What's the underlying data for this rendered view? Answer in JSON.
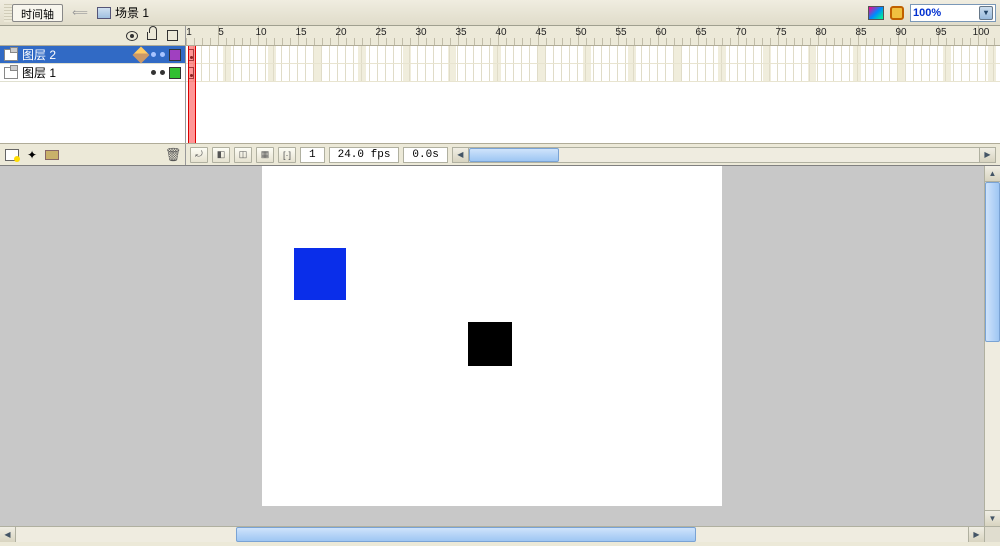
{
  "topbar": {
    "timeline_btn": "时间轴",
    "scene_label": "场景 1",
    "zoom_value": "100%"
  },
  "ruler": {
    "start": 1,
    "major_step": 5,
    "max": 105
  },
  "layers": [
    {
      "name": "图层 2",
      "selected": true,
      "color": "#a040c0"
    },
    {
      "name": "图层 1",
      "selected": false,
      "color": "#30c030"
    }
  ],
  "status": {
    "current_frame": "1",
    "fps": "24.0 fps",
    "elapsed": "0.0s"
  },
  "stage": {
    "shapes": [
      {
        "id": "blue-square",
        "color": "#0a2eea"
      },
      {
        "id": "black-square",
        "color": "#000000"
      }
    ]
  }
}
